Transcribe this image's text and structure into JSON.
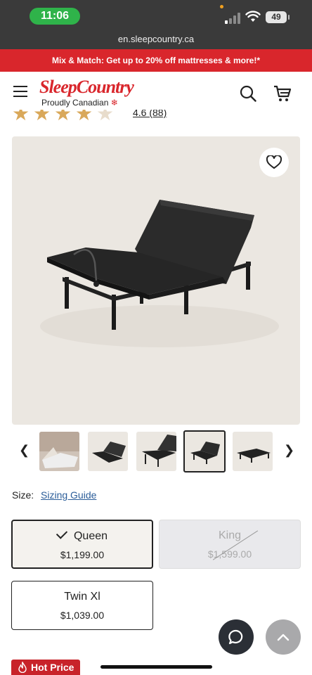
{
  "status_bar": {
    "time": "11:06",
    "battery": "49"
  },
  "browser": {
    "url": "en.sleepcountry.ca"
  },
  "promo": {
    "text": "Mix & Match: Get up to 20% off mattresses & more!*"
  },
  "header": {
    "logo": "SleepCountry",
    "tagline": "Proudly Canadian",
    "icons": [
      "menu-icon",
      "search-icon",
      "cart-icon"
    ]
  },
  "rating": {
    "text": "4.6 (88)"
  },
  "sizes": {
    "label": "Size:",
    "guide_link": "Sizing Guide",
    "options": [
      {
        "name": "Queen",
        "price": "$1,199.00",
        "selected": true
      },
      {
        "name": "King",
        "price": "$1,599.00",
        "available": false
      },
      {
        "name": "Twin Xl",
        "price": "$1,039.00"
      }
    ]
  },
  "badge": {
    "hot_price": "Hot Price"
  },
  "colors": {
    "brand_red": "#d9262c",
    "dark": "#222222",
    "status_green": "#2fb34a"
  }
}
